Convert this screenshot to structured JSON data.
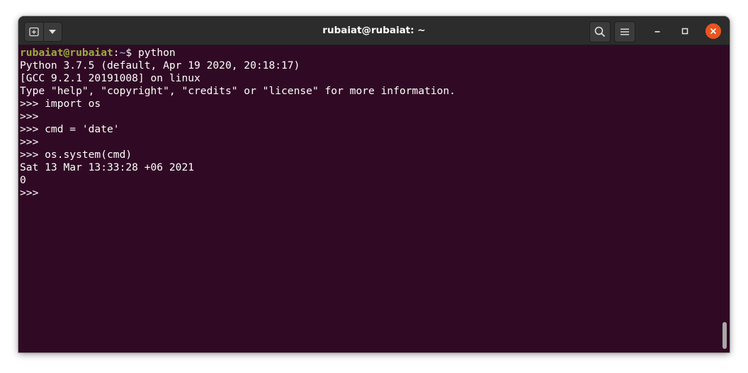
{
  "window": {
    "title": "rubaiat@rubaiat: ~"
  },
  "titlebar": {
    "new_tab_icon": "new-tab-icon",
    "menu_dropdown_icon": "chevron-down-icon",
    "search_icon": "search-icon",
    "hamburger_icon": "hamburger-menu-icon",
    "minimize_icon": "minimize-icon",
    "maximize_icon": "maximize-icon",
    "close_icon": "close-icon"
  },
  "colors": {
    "terminal_bg": "#300a24",
    "titlebar_bg": "#2c2c2c",
    "prompt_user": "#9aac41",
    "prompt_path": "#729fcf",
    "close_button": "#e9541f"
  },
  "terminal": {
    "prompt": {
      "user_host": "rubaiat@rubaiat",
      "separator": ":",
      "path": "~",
      "symbol": "$ ",
      "command": "python"
    },
    "lines": [
      "Python 3.7.5 (default, Apr 19 2020, 20:18:17)",
      "[GCC 9.2.1 20191008] on linux",
      "Type \"help\", \"copyright\", \"credits\" or \"license\" for more information.",
      ">>> import os",
      ">>>",
      ">>> cmd = 'date'",
      ">>>",
      ">>> os.system(cmd)",
      "Sat 13 Mar 13:33:28 +06 2021",
      "0",
      ">>>"
    ]
  }
}
